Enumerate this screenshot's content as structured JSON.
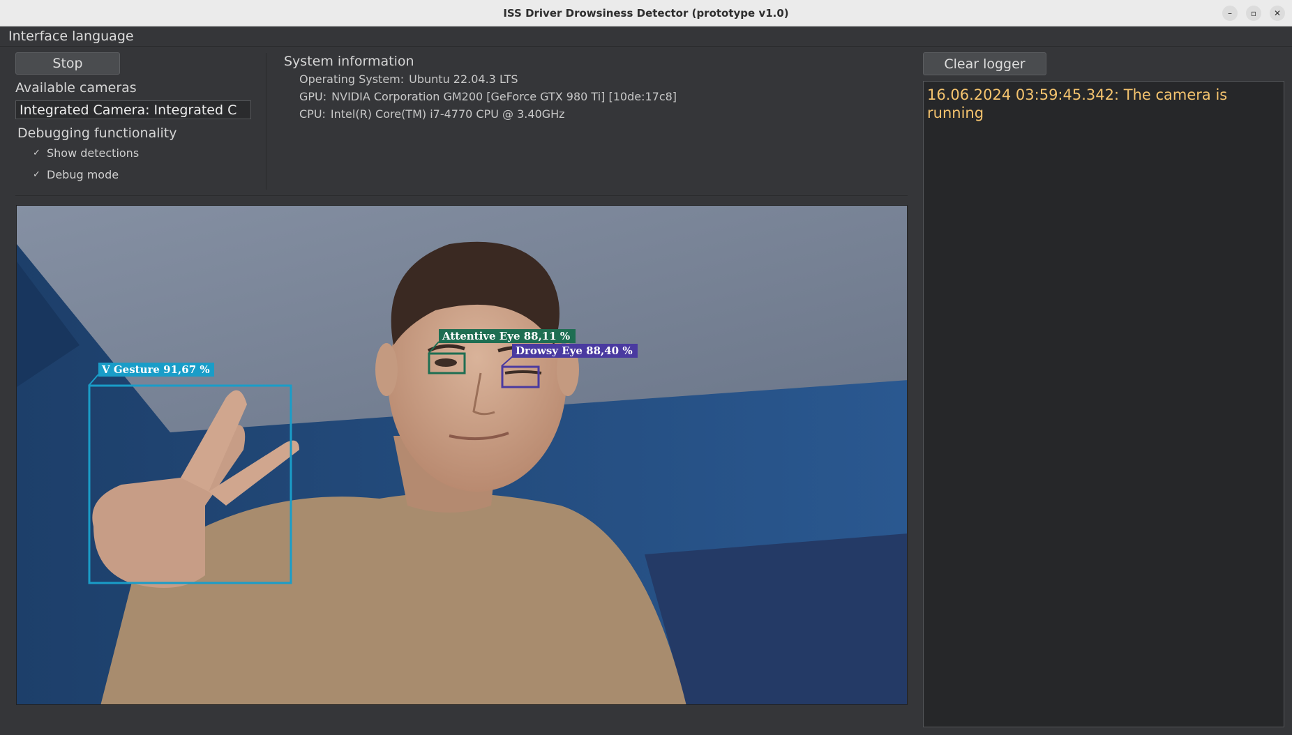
{
  "window": {
    "title": "ISS Driver Drowsiness Detector (prototype v1.0)",
    "controls": [
      "–",
      "▫",
      "✕"
    ]
  },
  "menubar": {
    "interface_language": "Interface language"
  },
  "left_panel": {
    "stop_label": "Stop",
    "cameras_label": "Available cameras",
    "selected_camera": "Integrated Camera: Integrated C",
    "debug_label": "Debugging functionality",
    "show_detections": {
      "label": "Show detections",
      "checked": true
    },
    "debug_mode": {
      "label": "Debug mode",
      "checked": true
    }
  },
  "system_info": {
    "title": "System information",
    "rows": [
      {
        "key": "Operating System:",
        "value": "Ubuntu 22.04.3 LTS"
      },
      {
        "key": "GPU:",
        "value": "NVIDIA Corporation GM200 [GeForce GTX 980 Ti] [10de:17c8]"
      },
      {
        "key": "CPU:",
        "value": "Intel(R) Core(TM) i7-4770 CPU @ 3.40GHz"
      }
    ]
  },
  "detections": [
    {
      "label": "V Gesture 91,67 %",
      "color": "#1a9dc8",
      "class": "v_gesture"
    },
    {
      "label": "Attentive Eye 88,11 %",
      "color": "#1e6e52",
      "class": "attentive_eye"
    },
    {
      "label": "Drowsy Eye 88,40 %",
      "color": "#4a3aa0",
      "class": "drowsy_eye"
    }
  ],
  "logger": {
    "clear_label": "Clear logger",
    "entries": [
      "16.06.2024 03:59:45.342: The camera is running"
    ]
  },
  "colors": {
    "window_bg": "#353639",
    "log_text": "#f4c36e",
    "attentive_box": "#1e6e52",
    "drowsy_box": "#4a3aa0",
    "gesture_box": "#1a9dc8"
  }
}
